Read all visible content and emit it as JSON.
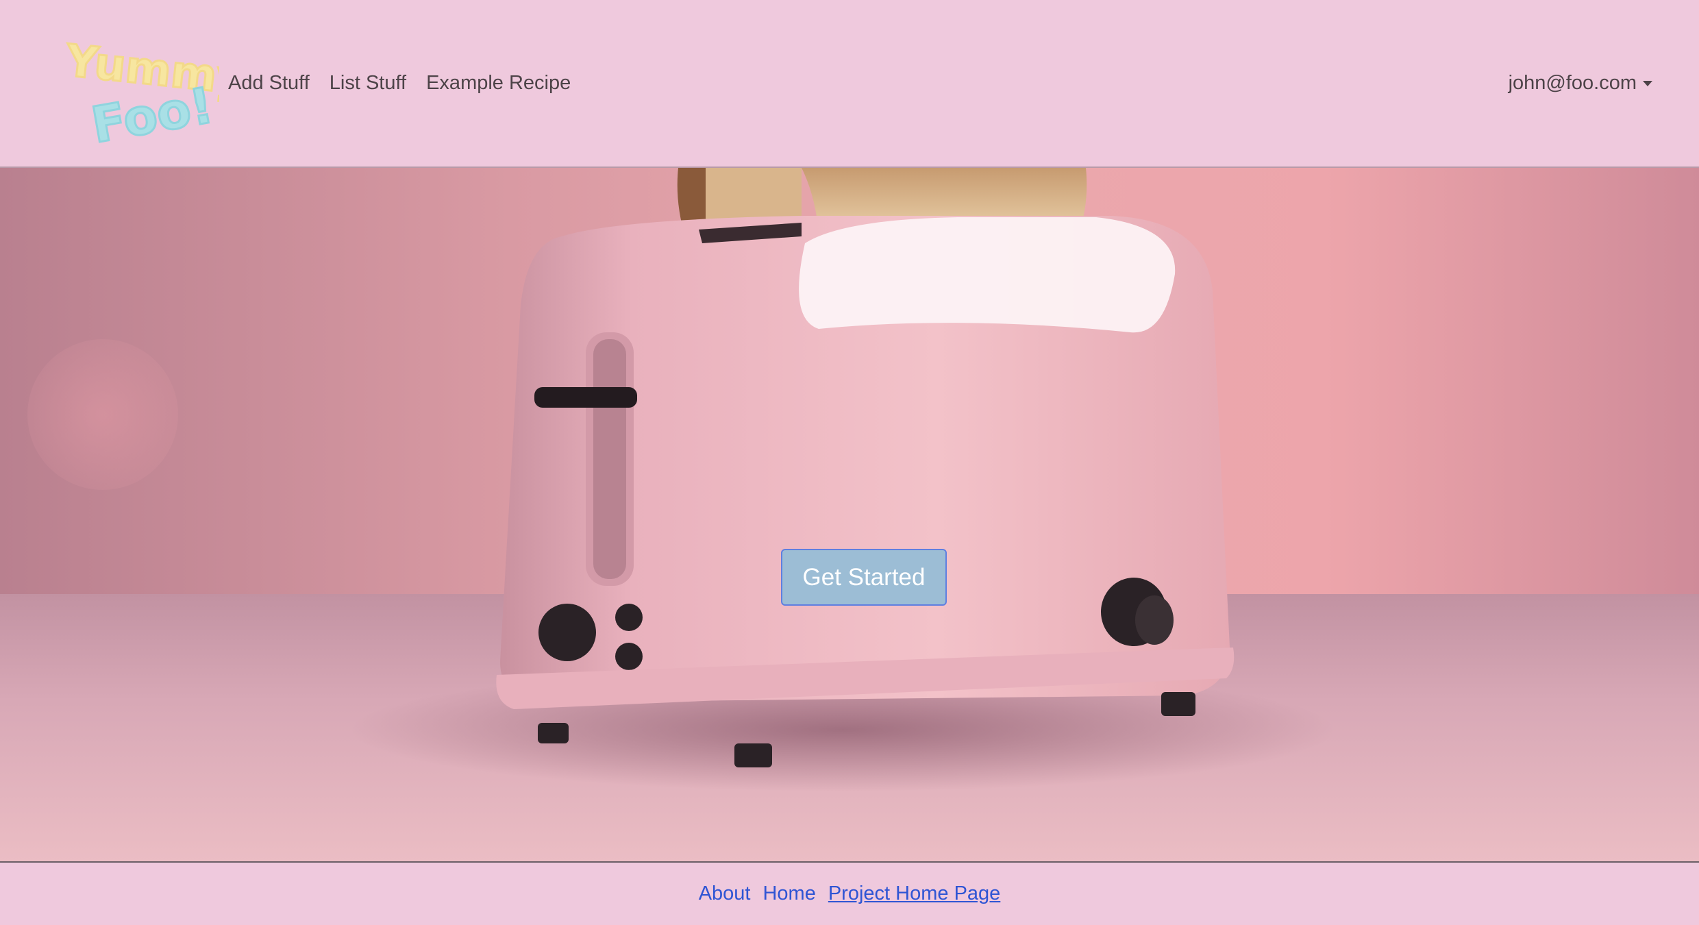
{
  "navbar": {
    "logo_text_top": "Yummy",
    "logo_text_bottom": "Foo!",
    "links": [
      "Add Stuff",
      "List Stuff",
      "Example Recipe"
    ],
    "user": "john@foo.com"
  },
  "hero": {
    "cta_label": "Get Started",
    "image": "pink-toaster-with-bread"
  },
  "footer": {
    "links": [
      "About",
      "Home",
      "Project Home Page"
    ]
  },
  "colors": {
    "background": "#efc9dd",
    "cta": "#9cbdd5",
    "link": "#2f55d4"
  }
}
